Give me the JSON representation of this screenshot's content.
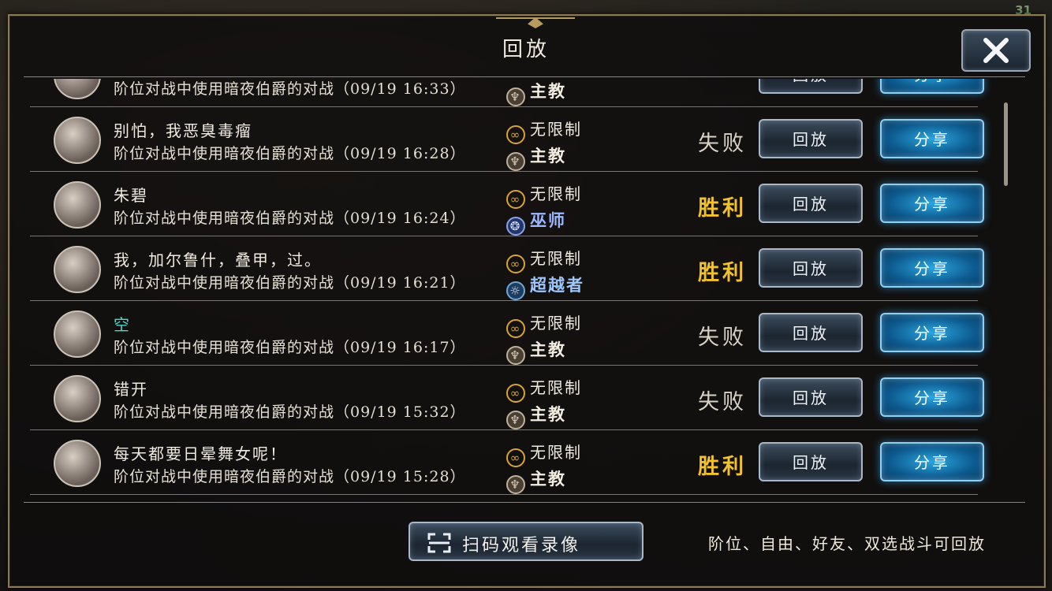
{
  "status": {
    "battery": "31"
  },
  "dialog": {
    "title": "回放"
  },
  "colors": {
    "win": "#f2c12e",
    "lose": "#d9d3c6",
    "share_blue": "#1a86c8",
    "gold_trim": "#b79a5e"
  },
  "labels": {
    "replay": "回放",
    "share": "分享"
  },
  "partial_row": {
    "desc": "阶位对战中使用暗夜伯爵的对战（09/19 16:33）",
    "cls": "主教"
  },
  "rows": [
    {
      "name": "别怕，我恶臭毒瘤",
      "desc": "阶位对战中使用暗夜伯爵的对战（09/19 16:28）",
      "mode": "无限制",
      "cls": "主教",
      "cls_icon": "bishop-class-icon",
      "result": "失败",
      "outcome": "lose"
    },
    {
      "name": "朱碧",
      "desc": "阶位对战中使用暗夜伯爵的对战（09/19 16:24）",
      "mode": "无限制",
      "cls": "巫师",
      "cls_icon": "witch-class-icon",
      "result": "胜利",
      "outcome": "win"
    },
    {
      "name": "我，加尔鲁什，叠甲，过。",
      "desc": "阶位对战中使用暗夜伯爵的对战（09/19 16:21）",
      "mode": "无限制",
      "cls": "超越者",
      "cls_icon": "transcendent-class-icon",
      "result": "胜利",
      "outcome": "win"
    },
    {
      "name": "空",
      "desc": "阶位对战中使用暗夜伯爵的对战（09/19 16:17）",
      "mode": "无限制",
      "cls": "主教",
      "cls_icon": "bishop-class-icon",
      "result": "失败",
      "outcome": "lose"
    },
    {
      "name": "错开",
      "desc": "阶位对战中使用暗夜伯爵的对战（09/19 15:32）",
      "mode": "无限制",
      "cls": "主教",
      "cls_icon": "bishop-class-icon",
      "result": "失败",
      "outcome": "lose"
    },
    {
      "name": "每天都要日晕舞女呢！",
      "desc": "阶位对战中使用暗夜伯爵的对战（09/19 15:28）",
      "mode": "无限制",
      "cls": "主教",
      "cls_icon": "bishop-class-icon",
      "result": "胜利",
      "outcome": "win"
    }
  ],
  "footer": {
    "scan_button": "扫码观看录像",
    "scan_icon": "qr-scan-icon",
    "note": "阶位、自由、好友、双选战斗可回放"
  }
}
